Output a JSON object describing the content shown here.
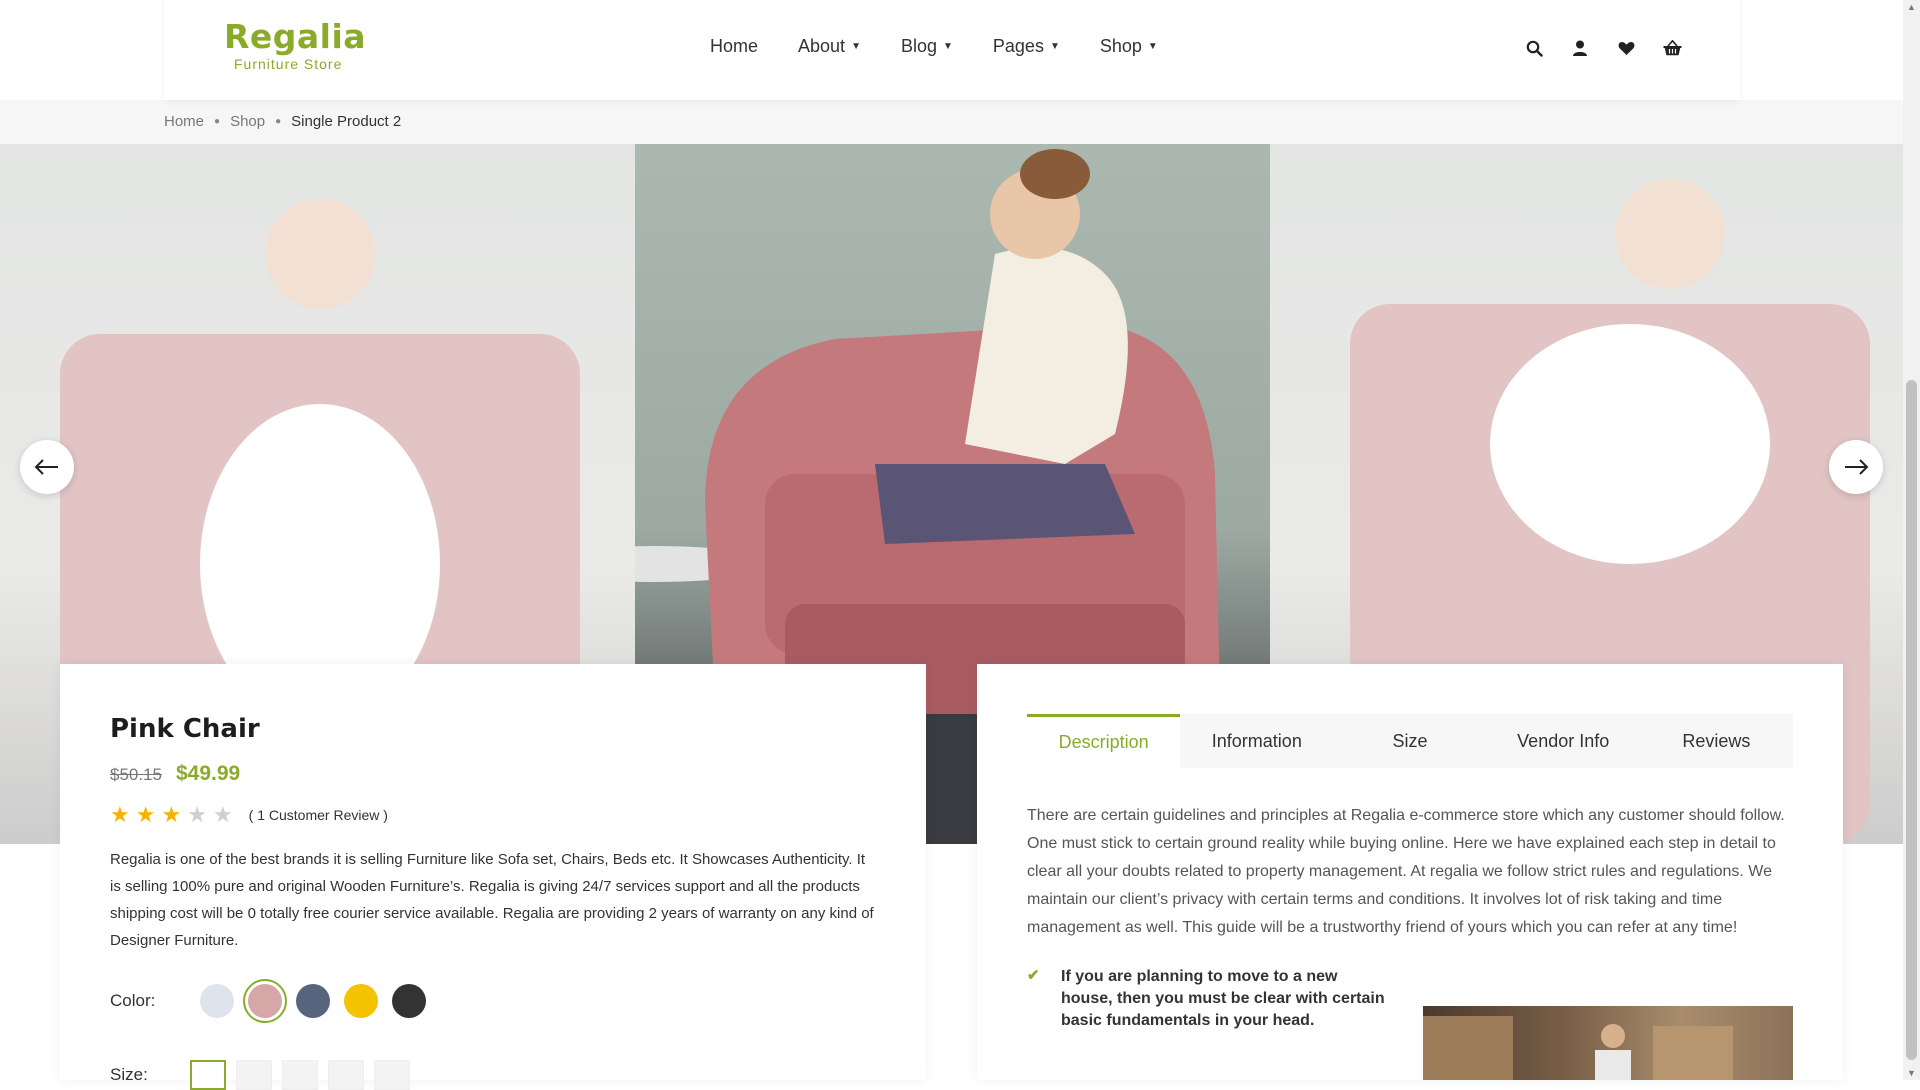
{
  "header": {
    "logo_name": "Regalia",
    "logo_sub": "Furniture Store",
    "nav": [
      {
        "label": "Home"
      },
      {
        "label": "About"
      },
      {
        "label": "Blog"
      },
      {
        "label": "Pages"
      },
      {
        "label": "Shop"
      }
    ],
    "icons": [
      "search-icon",
      "user-icon",
      "heart-icon",
      "basket-icon"
    ]
  },
  "breadcrumb": {
    "items": [
      "Home",
      "Shop",
      "Single Product 2"
    ]
  },
  "product": {
    "title": "Pink Chair",
    "old_price": "$50.15",
    "new_price": "$49.99",
    "rating": 3,
    "rating_max": 5,
    "review_count": "( 1 Customer Review )",
    "description": "Regalia is one of the best brands it is selling Furniture like Sofa set, Chairs, Beds etc. It Showcases Authenticity. It is selling 100% pure and original Wooden Furniture’s. Regalia is giving 24/7 services support and all the products shipping cost will be 0 totally free courier service available. Regalia are providing 2 years of warranty on any kind of Designer Furniture.",
    "color_label": "Color:",
    "colors": [
      "#dde4ee",
      "#d6a7a7",
      "#56647e",
      "#f5c200",
      "#333333"
    ],
    "selected_color_index": 1,
    "size_label": "Size:"
  },
  "tabs": {
    "items": [
      "Description",
      "Information",
      "Size",
      "Vendor Info",
      "Reviews"
    ],
    "active_index": 0,
    "description_text": "There are certain guidelines and principles at Regalia e-commerce store which any customer should follow. One must stick to certain ground reality while buying online. Here we have explained each step in detail to clear all your doubts related to property management. At regalia we follow strict rules and regulations. We maintain our client’s privacy with certain terms and conditions. It involves lot of risk taking and time management as well. This guide will be a trustworthy friend of yours which you can refer at any time!",
    "feature_text": "If you are planning to move to a new house, then you must be clear with certain basic fundamentals in your head."
  },
  "colors": {
    "accent": "#8aab2a",
    "star": "#f5b300"
  }
}
